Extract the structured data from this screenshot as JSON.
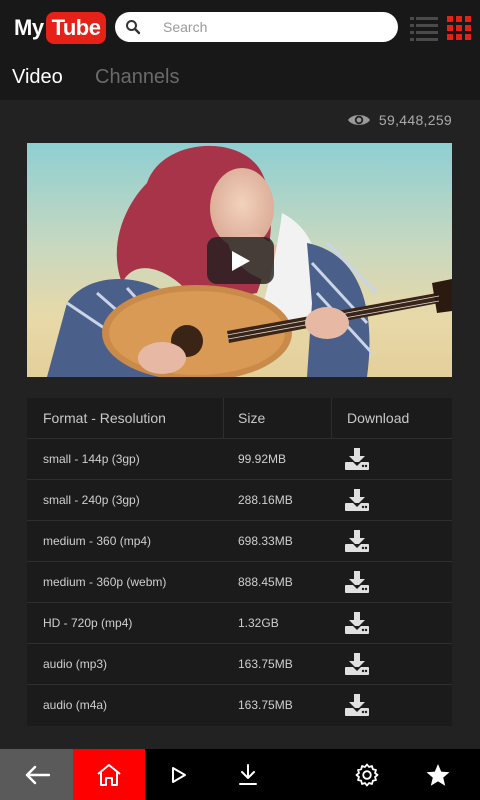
{
  "header": {
    "logo_my": "My",
    "logo_tube": "Tube",
    "search_placeholder": "Search",
    "search_value": ""
  },
  "tabs": [
    {
      "label": "Video",
      "active": true
    },
    {
      "label": "Channels",
      "active": false
    }
  ],
  "video": {
    "views": "59,448,259"
  },
  "table": {
    "headers": {
      "format": "Format - Resolution",
      "size": "Size",
      "download": "Download"
    },
    "rows": [
      {
        "format": "small - 144p (3gp)",
        "size": "99.92MB"
      },
      {
        "format": "small - 240p (3gp)",
        "size": "288.16MB"
      },
      {
        "format": "medium - 360 (mp4)",
        "size": "698.33MB"
      },
      {
        "format": "medium - 360p (webm)",
        "size": "888.45MB"
      },
      {
        "format": "HD - 720p (mp4)",
        "size": "1.32GB"
      },
      {
        "format": "audio (mp3)",
        "size": "163.75MB"
      },
      {
        "format": "audio (m4a)",
        "size": "163.75MB"
      }
    ]
  },
  "bottom_nav": [
    {
      "icon": "back-arrow-icon"
    },
    {
      "icon": "home-icon",
      "active": true
    },
    {
      "icon": "play-icon"
    },
    {
      "icon": "download-icon"
    },
    {
      "icon": "gear-icon"
    },
    {
      "icon": "star-icon"
    }
  ],
  "colors": {
    "brand_red": "#e62117",
    "active_nav": "#ff0000",
    "background": "#222222"
  }
}
